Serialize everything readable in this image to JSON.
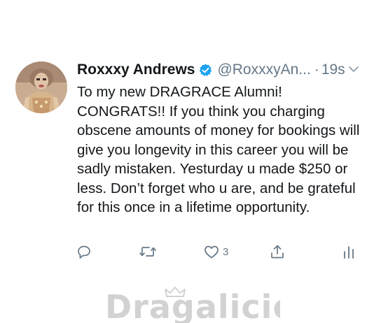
{
  "tweet": {
    "display_name": "Roxxxy Andrews",
    "handle": "@RoxxxyAn...",
    "separator": "·",
    "timestamp": "19s",
    "text": "To my new DRAGRACE Alumni!\nCONGRATS!! If you think you charging obscene amounts of money for bookings will give you longevity in this career you will be sadly mistaken. Yesturday u made $250 or less. Don’t forget who u are, and be grateful for this once in a lifetime opportunity.",
    "verified": true
  },
  "actions": {
    "reply_icon": "reply-icon",
    "retweet_icon": "retweet-icon",
    "like_icon": "heart-icon",
    "like_count": "3",
    "share_icon": "share-icon",
    "analytics_icon": "analytics-icon"
  },
  "watermark": {
    "text": "Dragalicious"
  },
  "colors": {
    "text": "#14171a",
    "secondary": "#657786",
    "verified": "#1da1f2",
    "watermark": "#d2d2d2"
  }
}
